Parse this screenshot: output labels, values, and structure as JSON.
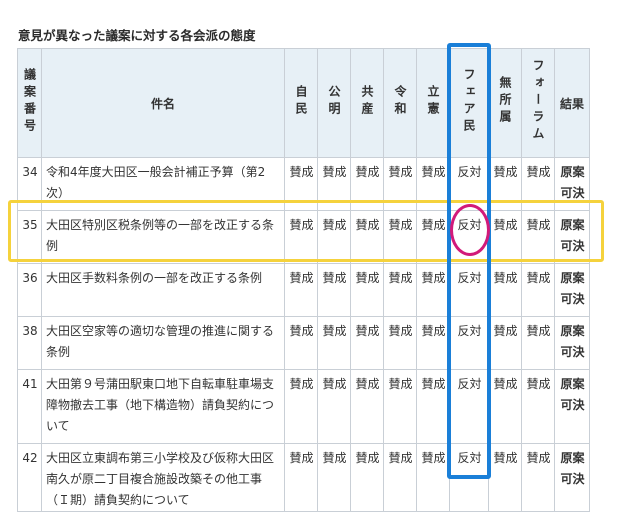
{
  "heading": "意見が異なった議案に対する各会派の態度",
  "headers": {
    "number": "議案番号",
    "name": "件名",
    "factions": [
      "自民",
      "公明",
      "共産",
      "令和",
      "立憲",
      "フェア民",
      "無所属",
      "フォーラム"
    ],
    "result": "結果"
  },
  "rows": [
    {
      "no": "34",
      "name": "令和4年度大田区一般会計補正予算（第2次）",
      "votes": [
        "賛成",
        "賛成",
        "賛成",
        "賛成",
        "賛成",
        "反対",
        "賛成",
        "賛成"
      ],
      "result": "原案可決"
    },
    {
      "no": "35",
      "name": "大田区特別区税条例等の一部を改正する条例",
      "votes": [
        "賛成",
        "賛成",
        "賛成",
        "賛成",
        "賛成",
        "反対",
        "賛成",
        "賛成"
      ],
      "result": "原案可決"
    },
    {
      "no": "36",
      "name": "大田区手数料条例の一部を改正する条例",
      "votes": [
        "賛成",
        "賛成",
        "賛成",
        "賛成",
        "賛成",
        "反対",
        "賛成",
        "賛成"
      ],
      "result": "原案可決"
    },
    {
      "no": "38",
      "name": "大田区空家等の適切な管理の推進に関する条例",
      "votes": [
        "賛成",
        "賛成",
        "賛成",
        "賛成",
        "賛成",
        "反対",
        "賛成",
        "賛成"
      ],
      "result": "原案可決"
    },
    {
      "no": "41",
      "name": "大田第９号蒲田駅東口地下自転車駐車場支障物撤去工事（地下構造物）請負契約について",
      "votes": [
        "賛成",
        "賛成",
        "賛成",
        "賛成",
        "賛成",
        "反対",
        "賛成",
        "賛成"
      ],
      "result": "原案可決"
    },
    {
      "no": "42",
      "name": "大田区立東調布第三小学校及び仮称大田区南久が原二丁目複合施設改築その他工事（Ｉ期）請負契約について",
      "votes": [
        "賛成",
        "賛成",
        "賛成",
        "賛成",
        "賛成",
        "反対",
        "賛成",
        "賛成"
      ],
      "result": "原案可決"
    }
  ],
  "annotations": {
    "highlight_color": "#f5d23c",
    "column_box_color": "#1a7fd8",
    "circle_color": "#d21a7a"
  }
}
